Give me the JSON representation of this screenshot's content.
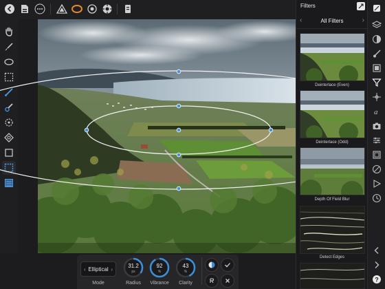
{
  "toolbar": {
    "icons": [
      "back-icon",
      "document-icon",
      "more-icon",
      "persona-tone-icon",
      "persona-develop-icon",
      "persona-liquify-icon",
      "persona-export-icon",
      "help-icon"
    ]
  },
  "tools": [
    "view-tool-icon",
    "selection-brush-icon",
    "elliptical-marquee-icon",
    "rectangular-marquee-icon",
    "pen-tool-icon",
    "brush-tool-icon",
    "flood-select-icon",
    "clone-tool-icon",
    "crop-tool-icon",
    "mask-tool-icon",
    "blend-ranges-icon"
  ],
  "context": {
    "mode_label": "Mode",
    "mode_value": "Elliptical",
    "radius": {
      "value": "31.2",
      "unit": "px",
      "label": "Radius",
      "level": 0.35
    },
    "vibrance": {
      "value": "92",
      "unit": "%",
      "label": "Vibrance",
      "level": 0.92
    },
    "clarity": {
      "value": "43",
      "unit": "%",
      "label": "Clarity",
      "level": 0.43
    },
    "accent": "#3c8fd9"
  },
  "panel": {
    "title": "Filters",
    "category": "All Filters",
    "items": [
      {
        "label": "Deinterlace (Even)"
      },
      {
        "label": "Deinterlace (Odd)"
      },
      {
        "label": "Depth Of Field Blur"
      },
      {
        "label": "Detect Edges"
      },
      {
        "label": ""
      }
    ]
  },
  "studio": {
    "icons": [
      "brushes-icon",
      "layers-icon",
      "adjustments-icon",
      "brush-studio-icon",
      "channels-icon",
      "filters-icon",
      "transform-icon",
      "styles-icon",
      "camera-icon",
      "sliders-icon",
      "crop-icon",
      "block-icon",
      "play-icon",
      "history-icon",
      "collapse-icon",
      "expand-icon",
      "help-icon"
    ]
  }
}
